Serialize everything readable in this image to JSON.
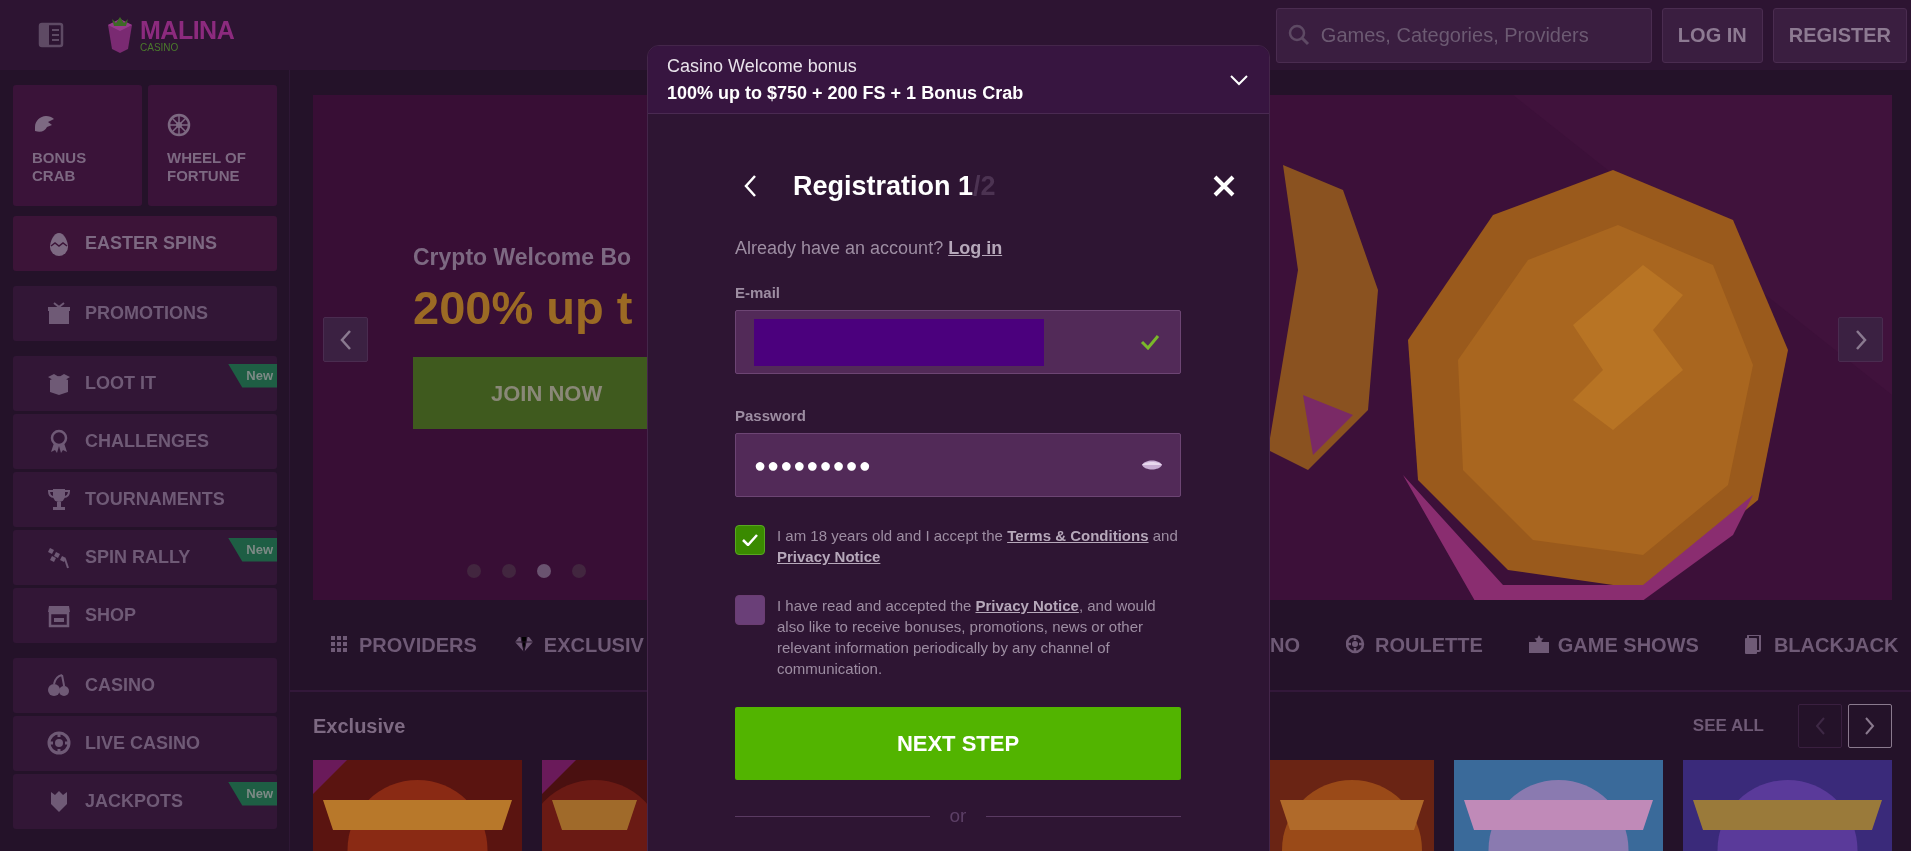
{
  "logo": {
    "name": "MALINA",
    "sub": "CASINO"
  },
  "header": {
    "search": {
      "placeholder": "Games, Categories, Providers"
    },
    "buttons": [
      "LOG IN",
      "REGISTER"
    ]
  },
  "sidebar": {
    "tiles": [
      {
        "label": "BONUS CRAB"
      },
      {
        "label": "WHEEL OF FORTUNE"
      }
    ],
    "featured": {
      "label": "EASTER SPINS"
    },
    "groups": [
      [
        {
          "label": "PROMOTIONS"
        }
      ],
      [
        {
          "label": "LOOT IT",
          "badge": "New"
        },
        {
          "label": "CHALLENGES"
        },
        {
          "label": "TOURNAMENTS"
        },
        {
          "label": "SPIN RALLY",
          "badge": "New"
        },
        {
          "label": "SHOP"
        }
      ],
      [
        {
          "label": "CASINO"
        },
        {
          "label": "LIVE CASINO"
        },
        {
          "label": "JACKPOTS",
          "badge": "New"
        }
      ]
    ]
  },
  "banner": {
    "subtitle": "Crypto Welcome Bo",
    "headline": "200% up t",
    "button": "JOIN NOW",
    "slides": [
      {
        "selected": false
      },
      {
        "selected": false
      },
      {
        "selected": true
      },
      {
        "selected": false
      }
    ]
  },
  "categories_left": [
    {
      "label": "PROVIDERS"
    },
    {
      "label": "EXCLUSIV"
    }
  ],
  "categories_right": [
    {
      "label": "NO"
    },
    {
      "label": "ROULETTE"
    },
    {
      "label": "GAME SHOWS"
    },
    {
      "label": "BLACKJACK"
    }
  ],
  "section": {
    "title": "Exclusive",
    "see_all": "SEE ALL"
  },
  "modal": {
    "offer": {
      "title": "Casino Welcome bonus",
      "detail": "100% up to $750 + 200 FS + 1 Bonus Crab",
      "expanded": false
    },
    "title": "Registration 1",
    "step_total": "/2",
    "login_prompt": "Already have an account?",
    "login_link": "Log in",
    "email": {
      "label": "E-mail",
      "redacted": true,
      "valid": true
    },
    "password": {
      "label": "Password",
      "value": "●●●●●●●●●"
    },
    "consents": [
      {
        "checked": true,
        "parts": [
          {
            "text": "I am 18 years old and I accept the "
          },
          {
            "link": "Terms & Conditions"
          },
          {
            "text": " and "
          },
          {
            "link": "Privacy Notice"
          }
        ]
      },
      {
        "checked": false,
        "parts": [
          {
            "text": "I have read and accepted the "
          },
          {
            "link": "Privacy Notice"
          },
          {
            "text": ", and would also like to receive bonuses, promotions, news or other relevant information periodically by any channel of communication."
          }
        ]
      }
    ],
    "submit": "NEXT STEP",
    "divider": "or"
  }
}
